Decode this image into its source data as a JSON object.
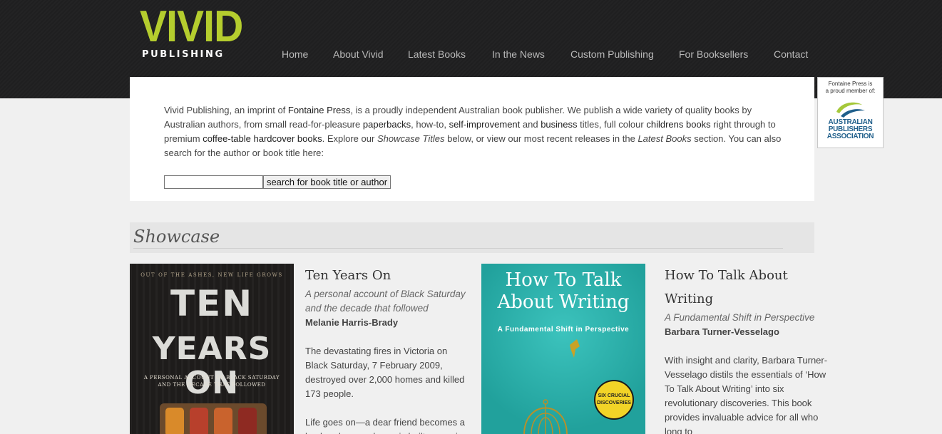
{
  "logo": {
    "line1": "VIVID",
    "line2": "PUBLISHING",
    "brand_color": "#b5cd2e"
  },
  "nav": [
    {
      "label": "Home"
    },
    {
      "label": "About Vivid"
    },
    {
      "label": "Latest Books"
    },
    {
      "label": "In the News"
    },
    {
      "label": "Custom Publishing"
    },
    {
      "label": "For Booksellers"
    },
    {
      "label": "Contact"
    }
  ],
  "apa": {
    "line1": "Fontaine Press is",
    "line2": "a proud member of:",
    "org1": "AUSTRALIAN",
    "org2": "PUBLISHERS",
    "org3": "ASSOCIATION"
  },
  "intro": {
    "p1": "Vivid Publishing, an imprint of ",
    "k1": "Fontaine Press",
    "p2": ", is a proudly independent Australian book publisher. We publish a wide variety of quality books by Australian authors, from small read-for-pleasure ",
    "k2": "paperbacks",
    "p3": ", how-to, ",
    "k3": "self-improvement",
    "p4": " and ",
    "k4": "business",
    "p5": " titles, full colour ",
    "k5": "childrens books",
    "p6": " right through to premium ",
    "k6": "coffee-table hardcover books",
    "p7": ". Explore our ",
    "e1": "Showcase Titles",
    "p8": " below, or view our most recent releases in the ",
    "e2": "Latest Books",
    "p9": " section. You can also search for the author or book title here:"
  },
  "search": {
    "value": "",
    "button_label": "search for book title or author"
  },
  "showcase": {
    "heading": "Showcase"
  },
  "books": [
    {
      "cover": {
        "tagline": "OUT OF THE ASHES, NEW LIFE GROWS",
        "title_line1": "TEN",
        "title_line2": "YEARS ON",
        "sub_line1": "A PERSONAL ACCOUNT OF BLACK SATURDAY",
        "sub_line2": "AND THE DECADE THAT FOLLOWED"
      },
      "title": "Ten Years On",
      "subtitle": "A personal account of Black Saturday and the decade that followed",
      "author": "Melanie Harris-Brady",
      "desc": "The devastating fires in Victoria on Black Saturday, 7 February 2009, destroyed over 2,000 homes and killed 173 people.",
      "desc2": "Life goes on—a dear friend becomes a husband, a new home is built, a son is"
    },
    {
      "cover": {
        "title_line1": "How To Talk",
        "title_line2": "About Writing",
        "sub": "A Fundamental Shift in Perspective",
        "badge_line1": "SIX CRUCIAL",
        "badge_line2": "DISCOVERIES"
      },
      "title_line1": "How To Talk About",
      "title_line2": "Writing",
      "subtitle": "A Fundamental Shift in Perspective",
      "author": "Barbara Turner-Vesselago",
      "desc": "With insight and clarity, Barbara Turner-Vesselago distils the essentials of ‘How To Talk About Writing’ into six revolutionary discoveries. This book provides invaluable advice for all who long to"
    }
  ]
}
